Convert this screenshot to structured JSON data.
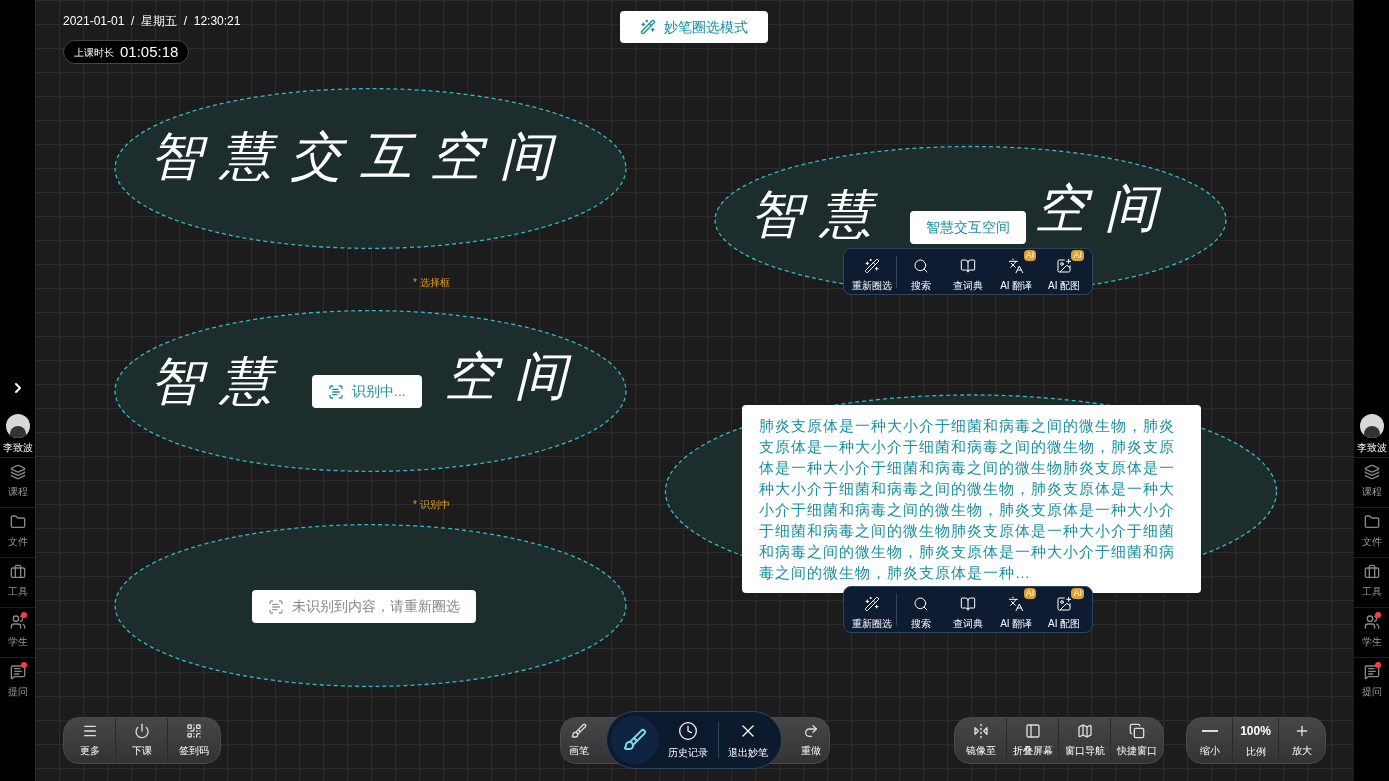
{
  "header": {
    "datetime": "2021-01-01  /  星期五  /  12:30:21"
  },
  "session": {
    "label": "上课时长",
    "time": "01:05:18"
  },
  "mode_badge": {
    "label": "妙笔圈选模式"
  },
  "selections": [
    {
      "kind": "handwriting",
      "text": "智慧交互空间"
    },
    {
      "kind": "result",
      "handwriting_left": "智慧",
      "handwriting_right": "空间",
      "result": "智慧交互空间"
    },
    {
      "kind": "recognizing",
      "handwriting_left": "智慧",
      "handwriting_right": "空间",
      "status": "识别中..."
    },
    {
      "kind": "failed",
      "message": "未识别到内容，请重新圈选"
    },
    {
      "kind": "paragraph",
      "text": "肺炎支原体是一种大小介于细菌和病毒之间的微生物，肺炎支原体是一种大小介于细菌和病毒之间的微生物，肺炎支原体是一种大小介于细菌和病毒之间的微生物肺炎支原体是一种大小介于细菌和病毒之间的微生物，肺炎支原体是一种大小介于细菌和病毒之间的微生物，肺炎支原体是一种大小介于细菌和病毒之间的微生物肺炎支原体是一种大小介于细菌和病毒之间的微生物，肺炎支原体是一种大小介于细菌和病毒之间的微生物，肺炎支原体是一种…"
    }
  ],
  "annotations": [
    "* 选择框",
    "* 识别中"
  ],
  "result_toolbars": [
    {
      "items": [
        {
          "label": "重新圈选"
        },
        {
          "label": "搜索"
        },
        {
          "label": "查词典"
        },
        {
          "label": "AI 翻译",
          "badge": "AI"
        },
        {
          "label": "AI 配图",
          "badge": "AI"
        }
      ]
    },
    {
      "items": [
        {
          "label": "重新圈选"
        },
        {
          "label": "搜索"
        },
        {
          "label": "查词典"
        },
        {
          "label": "AI 翻译",
          "badge": "AI"
        },
        {
          "label": "AI 配图",
          "badge": "AI"
        }
      ]
    }
  ],
  "left_sidebar": {
    "user": "李致波",
    "items": [
      {
        "label": "课程",
        "notification": false
      },
      {
        "label": "文件",
        "notification": false
      },
      {
        "label": "工具",
        "notification": false
      },
      {
        "label": "学生",
        "notification": true
      },
      {
        "label": "提问",
        "notification": true
      }
    ]
  },
  "right_sidebar": {
    "user": "李致波",
    "items": [
      {
        "label": "课程",
        "notification": false
      },
      {
        "label": "文件",
        "notification": false
      },
      {
        "label": "工具",
        "notification": false
      },
      {
        "label": "学生",
        "notification": true
      },
      {
        "label": "提问",
        "notification": true
      }
    ]
  },
  "bottom_left": [
    "更多",
    "下课",
    "签到码"
  ],
  "pen_group": [
    "画笔",
    "重做"
  ],
  "magic_pen_bar": [
    "历史记录",
    "退出妙笔"
  ],
  "window_group": [
    "镜像至",
    "折叠屏幕",
    "窗口导航",
    "快捷窗口"
  ],
  "zoom_group": {
    "out": "缩小",
    "scale": "100%",
    "scale_label": "比例",
    "in": "放大"
  }
}
